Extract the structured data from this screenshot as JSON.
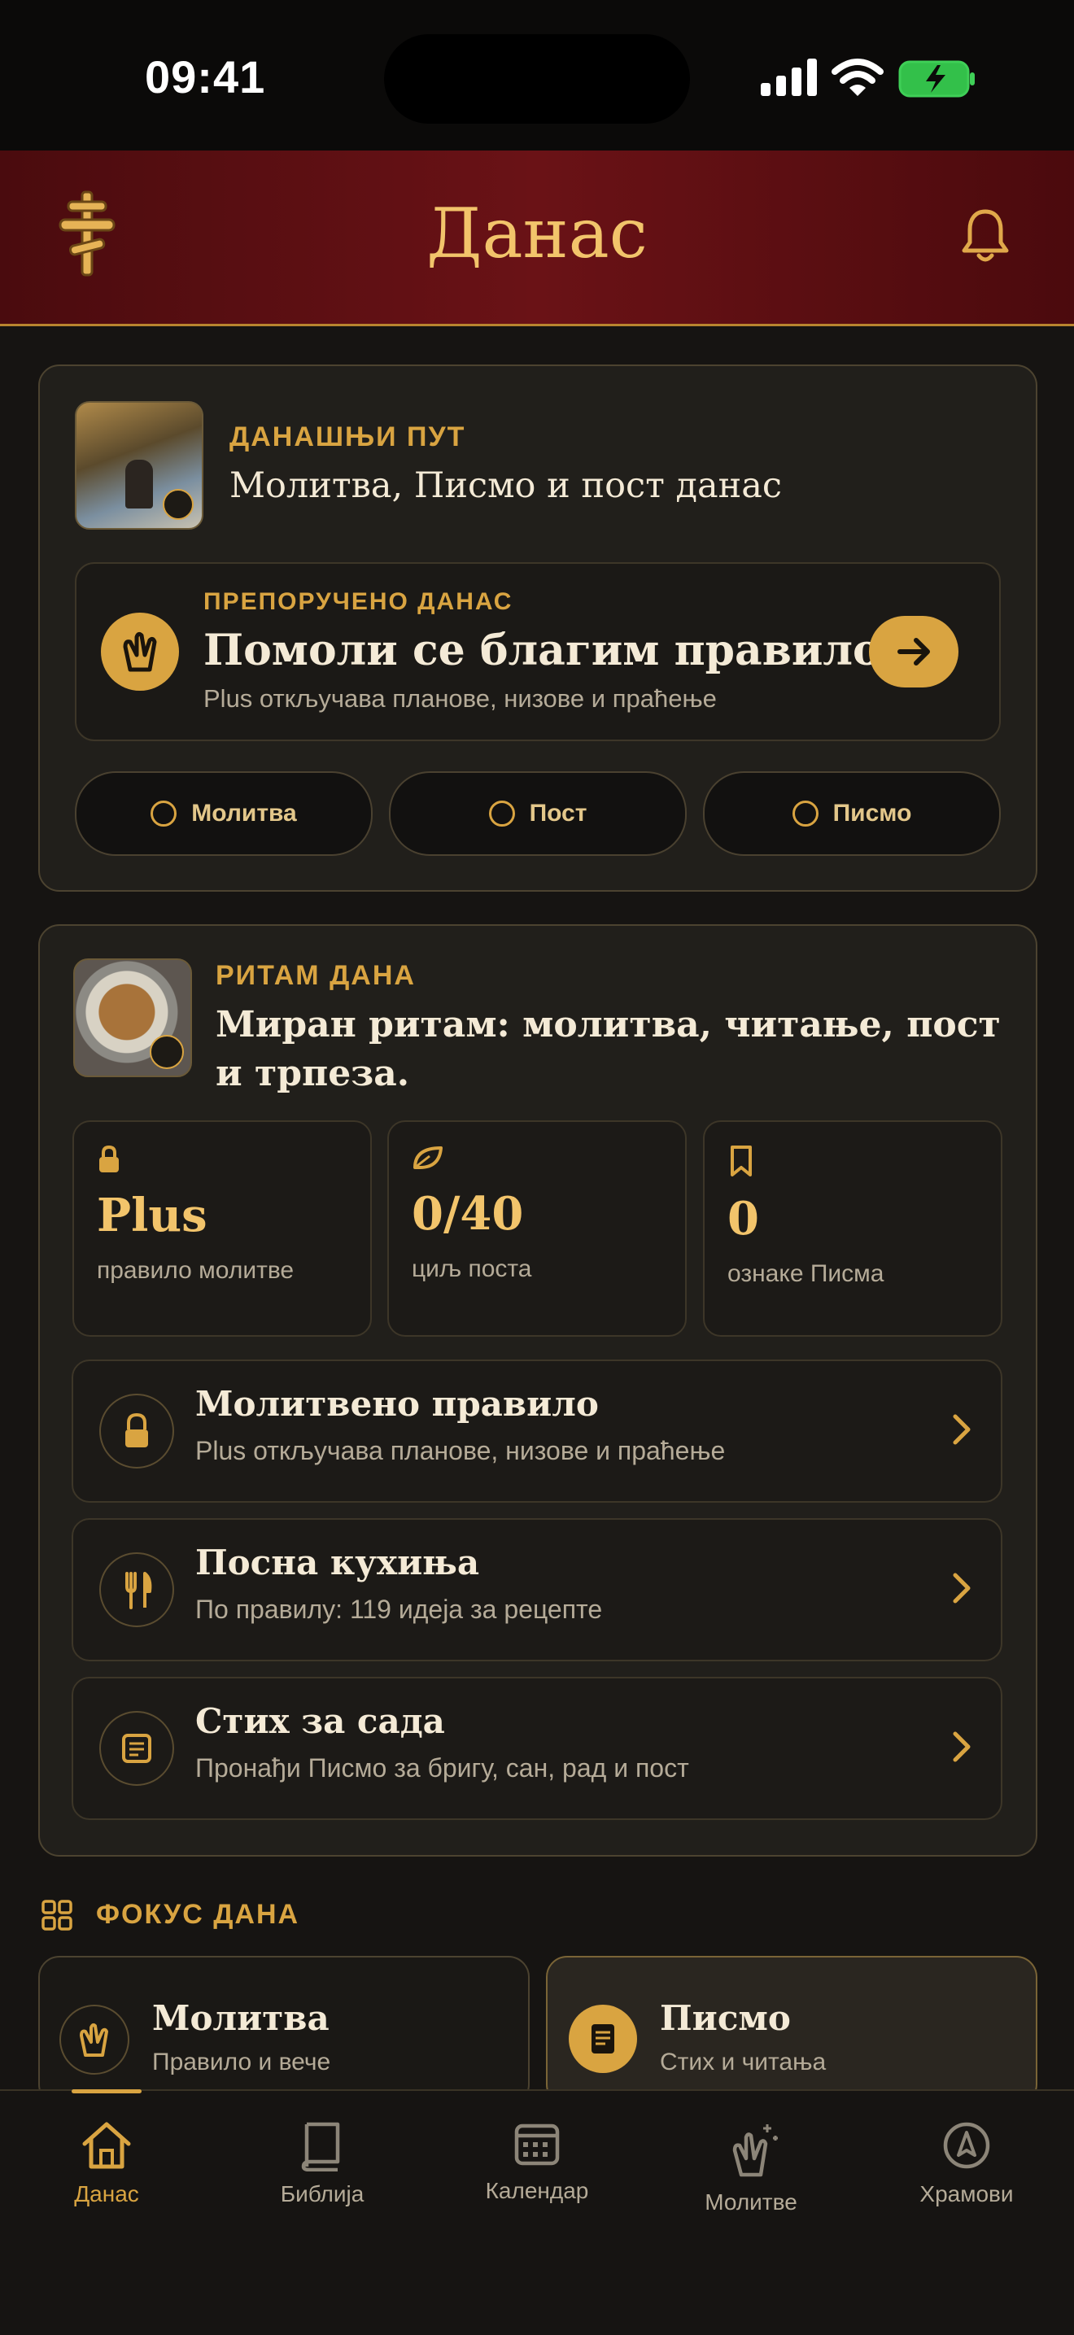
{
  "status": {
    "time": "09:41"
  },
  "header": {
    "title": "Данас"
  },
  "path_card": {
    "kicker": "ДАНАШЊИ ПУТ",
    "title": "Молитва, Писмо и пост данас",
    "recommended": {
      "kicker": "ПРЕПОРУЧЕНО ДАНАС",
      "title": "Помоли се благим правилом",
      "subtitle": "Plus откључава планове, низове и праћење"
    },
    "pills": [
      "Молитва",
      "Пост",
      "Писмо"
    ]
  },
  "rhythm_card": {
    "kicker": "РИТАМ ДАНА",
    "title_line1": "Миран ритам: молитва, читање, пост",
    "title_line2": "и трпеза.",
    "stats": [
      {
        "icon": "lock-icon",
        "value": "Plus",
        "label": "правило молитве"
      },
      {
        "icon": "leaf-icon",
        "value": "0/40",
        "label": "циљ поста"
      },
      {
        "icon": "bookmark-icon",
        "value": "0",
        "label": "ознаке Писма"
      }
    ],
    "rows": [
      {
        "icon": "lock-icon",
        "title": "Молитвено правило",
        "subtitle": "Plus откључава планове, низове и праћење"
      },
      {
        "icon": "fork-knife-icon",
        "title": "Посна кухиња",
        "subtitle": "По правилу: 119 идеја за рецепте"
      },
      {
        "icon": "scripture-icon",
        "title": "Стих за сада",
        "subtitle": "Пронађи Писмо за бригу, сан, рад и пост"
      }
    ]
  },
  "focus": {
    "heading": "ФОКУС ДАНА",
    "cards": [
      {
        "title": "Молитва",
        "subtitle": "Правило и вече"
      },
      {
        "title": "Писмо",
        "subtitle": "Стих и читања"
      }
    ]
  },
  "tabs": [
    {
      "label": "Данас",
      "active": true
    },
    {
      "label": "Библија",
      "active": false
    },
    {
      "label": "Календар",
      "active": false
    },
    {
      "label": "Молитве",
      "active": false
    },
    {
      "label": "Храмови",
      "active": false
    }
  ],
  "colors": {
    "accent": "#d9a441",
    "header_red": "#5e0f13",
    "background": "#161412",
    "card": "#211f1b"
  }
}
